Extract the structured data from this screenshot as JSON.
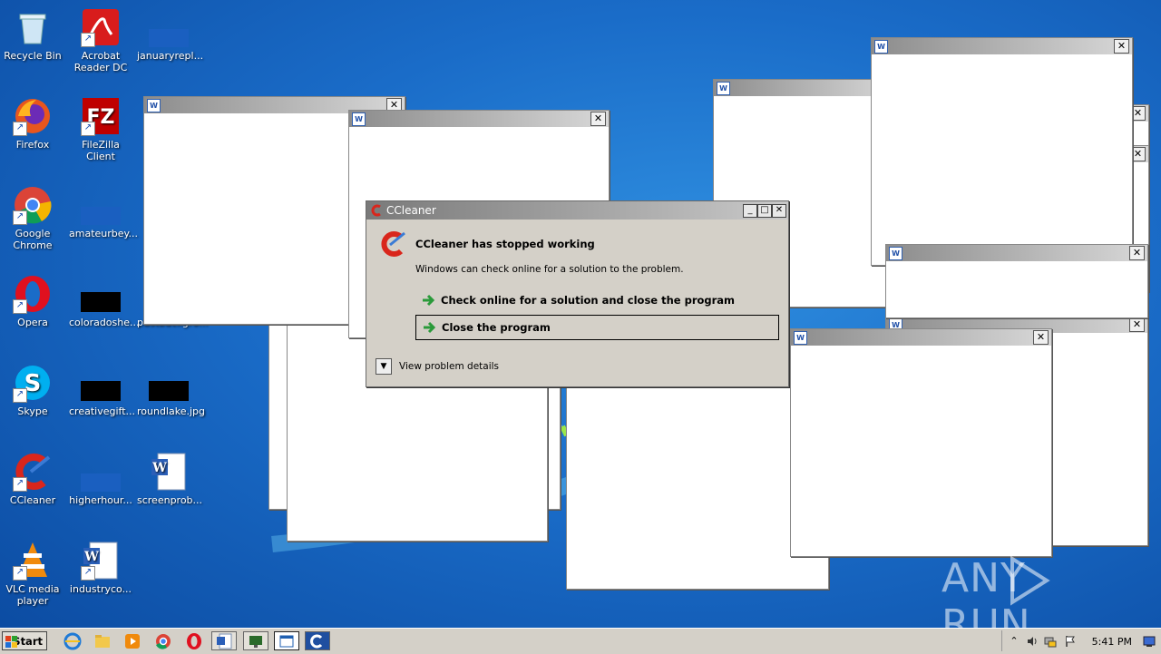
{
  "desktop": {
    "icons": [
      {
        "label": "Recycle Bin",
        "icon": "recycle-bin-icon"
      },
      {
        "label": "Acrobat Reader DC",
        "icon": "acrobat-icon"
      },
      {
        "label": "januaryrepl...",
        "icon": "file-icon"
      },
      {
        "label": "Firefox",
        "icon": "firefox-icon"
      },
      {
        "label": "FileZilla Client",
        "icon": "filezilla-icon"
      },
      {
        "label": "Google Chrome",
        "icon": "chrome-icon"
      },
      {
        "label": "amateurbey...",
        "icon": "file-icon"
      },
      {
        "label": "Opera",
        "icon": "opera-icon"
      },
      {
        "label": "coloradoshe...",
        "icon": "file-icon"
      },
      {
        "label": "pastbackgro...",
        "icon": "file-icon"
      },
      {
        "label": "Skype",
        "icon": "skype-icon"
      },
      {
        "label": "creativegift...",
        "icon": "file-icon"
      },
      {
        "label": "roundlake.jpg",
        "icon": "image-icon"
      },
      {
        "label": "CCleaner",
        "icon": "ccleaner-icon"
      },
      {
        "label": "higherhour...",
        "icon": "file-icon"
      },
      {
        "label": "screenprob...",
        "icon": "word-doc-icon"
      },
      {
        "label": "VLC media player",
        "icon": "vlc-icon"
      },
      {
        "label": "industryco...",
        "icon": "word-doc-icon"
      }
    ]
  },
  "dialog": {
    "title": "CCleaner",
    "heading": "CCleaner has stopped working",
    "message": "Windows can check online for a solution to the problem.",
    "option_check": "Check online for a solution and close the program",
    "option_close": "Close the program",
    "details": "View problem details",
    "minimize": "_",
    "maximize": "□",
    "close": "✕"
  },
  "windows": {
    "close_glyph": "✕",
    "word_glyph": "W"
  },
  "taskbar": {
    "start_label": "Start",
    "clock": "5:41 PM",
    "tray_up": "⌃",
    "tray_speaker": "🔊"
  },
  "watermark": {
    "left": "ANY",
    "right": "RUN"
  },
  "colors": {
    "desktop_blue": "#1a6cc8",
    "dialog_gray": "#d4d0c8",
    "arrow_green": "#2a9a3a"
  }
}
